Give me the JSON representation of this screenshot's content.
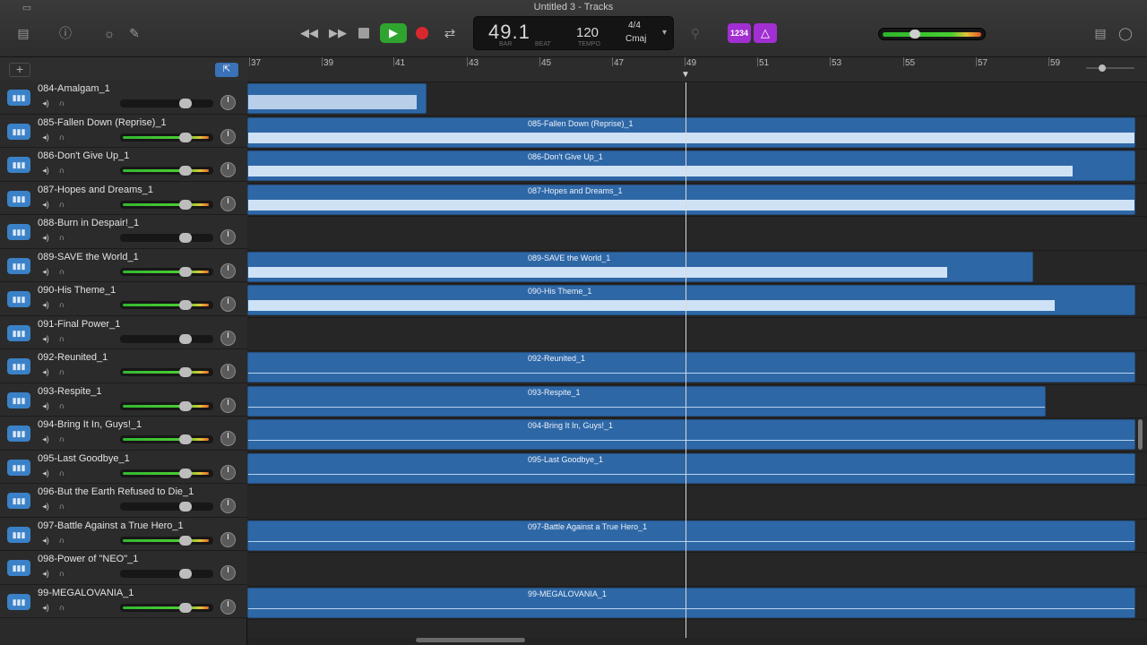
{
  "window": {
    "title": "Untitled 3 - Tracks"
  },
  "transport": {
    "rewind_icon": "rewind-icon",
    "forward_icon": "fast-forward-icon",
    "play_icon": "play-icon",
    "cycle_icon": "cycle-icon"
  },
  "lcd": {
    "position": "49.1",
    "bar_label": "BAR",
    "beat_label": "BEAT",
    "tempo": "120",
    "tempo_label": "TEMPO",
    "time_signature": "4/4",
    "key": "Cmaj"
  },
  "count_in": {
    "label": "1234"
  },
  "master_volume": {
    "level": 0.3
  },
  "ruler": {
    "bars": [
      "37",
      "39",
      "41",
      "43",
      "45",
      "47",
      "49",
      "51",
      "53",
      "55",
      "57",
      "59"
    ]
  },
  "tracks": [
    {
      "name": "084-Amalgam_1",
      "volume_active": false,
      "region": ""
    },
    {
      "name": "085-Fallen Down (Reprise)_1",
      "volume_active": true,
      "region": "085-Fallen Down (Reprise)_1"
    },
    {
      "name": "086-Don't Give Up_1",
      "volume_active": true,
      "region": "086-Don't Give Up_1"
    },
    {
      "name": "087-Hopes and Dreams_1",
      "volume_active": true,
      "region": "087-Hopes and Dreams_1"
    },
    {
      "name": "088-Burn in Despair!_1",
      "volume_active": false,
      "region": ""
    },
    {
      "name": "089-SAVE the World_1",
      "volume_active": true,
      "region": "089-SAVE the World_1"
    },
    {
      "name": "090-His Theme_1",
      "volume_active": true,
      "region": "090-His Theme_1"
    },
    {
      "name": "091-Final Power_1",
      "volume_active": false,
      "region": ""
    },
    {
      "name": "092-Reunited_1",
      "volume_active": true,
      "region": "092-Reunited_1"
    },
    {
      "name": "093-Respite_1",
      "volume_active": true,
      "region": "093-Respite_1"
    },
    {
      "name": "094-Bring It In, Guys!_1",
      "volume_active": true,
      "region": "094-Bring It In, Guys!_1"
    },
    {
      "name": "095-Last Goodbye_1",
      "volume_active": true,
      "region": "095-Last Goodbye_1"
    },
    {
      "name": "096-But the Earth Refused to Die_1",
      "volume_active": false,
      "region": ""
    },
    {
      "name": "097-Battle Against a True Hero_1",
      "volume_active": true,
      "region": "097-Battle Against a True Hero_1"
    },
    {
      "name": "098-Power of \"NEO\"_1",
      "volume_active": false,
      "region": ""
    },
    {
      "name": "99-MEGALOVANIA_1",
      "volume_active": true,
      "region": "99-MEGALOVANIA_1"
    }
  ]
}
